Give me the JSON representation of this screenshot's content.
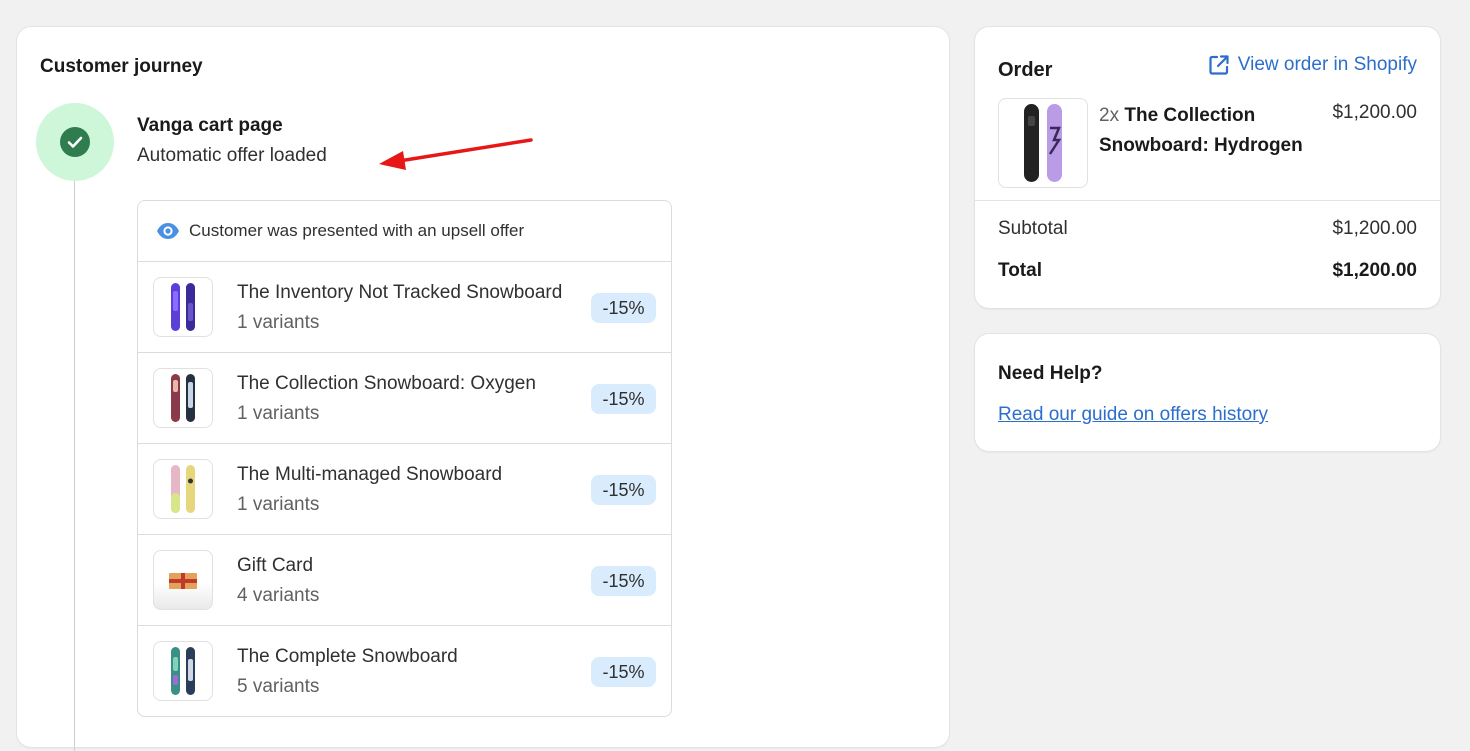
{
  "journey": {
    "title": "Customer journey",
    "step": {
      "title": "Vanga cart page",
      "subtitle": "Automatic offer loaded"
    },
    "offer": {
      "header": "Customer was presented with an upsell offer",
      "items": [
        {
          "name": "The Inventory Not Tracked Snowboard",
          "variants": "1 variants",
          "badge": "-15%"
        },
        {
          "name": "The Collection Snowboard: Oxygen",
          "variants": "1 variants",
          "badge": "-15%"
        },
        {
          "name": "The Multi-managed Snowboard",
          "variants": "1 variants",
          "badge": "-15%"
        },
        {
          "name": "Gift Card",
          "variants": "4 variants",
          "badge": "-15%"
        },
        {
          "name": "The Complete Snowboard",
          "variants": "5 variants",
          "badge": "-15%"
        }
      ]
    }
  },
  "order": {
    "title": "Order",
    "view_link": "View order in Shopify",
    "item": {
      "qty": "2x",
      "name": "The Collection Snowboard: Hydrogen",
      "price": "$1,200.00"
    },
    "subtotal_label": "Subtotal",
    "subtotal_value": "$1,200.00",
    "total_label": "Total",
    "total_value": "$1,200.00"
  },
  "help": {
    "title": "Need Help?",
    "link": "Read our guide on offers history"
  },
  "colors": {
    "accent_link": "#2c6ecb",
    "success_bg": "#cdf7d8",
    "success": "#2f7d4f",
    "badge_bg": "#d8ecfd",
    "annotation_arrow": "#e81717"
  },
  "icons": [
    "check-icon",
    "eye-icon",
    "external-link-icon",
    "annotation-arrow"
  ]
}
